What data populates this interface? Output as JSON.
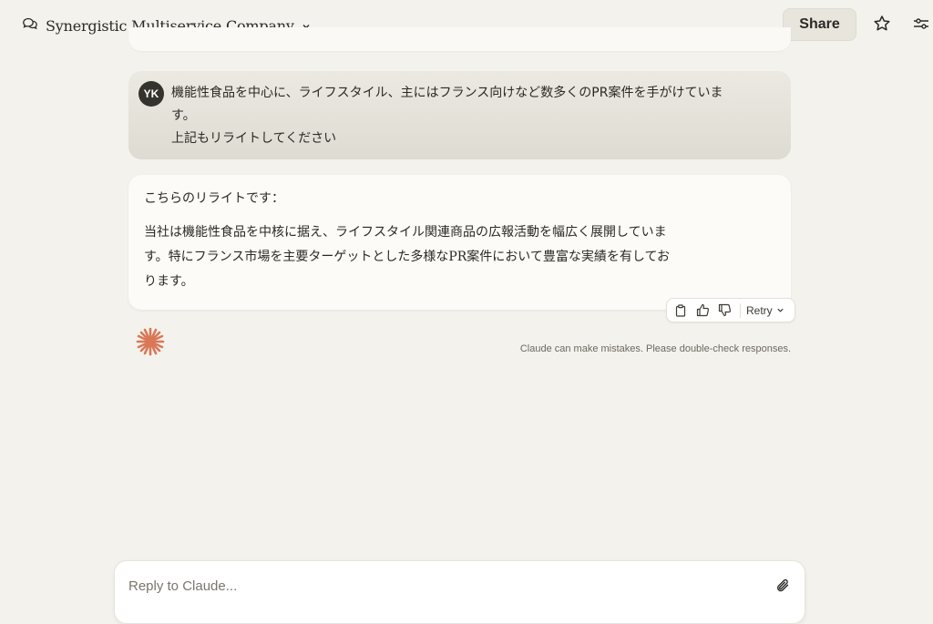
{
  "header": {
    "chat_icon": "chat-bubbles-icon",
    "title": "Synergistic Multiservice Company",
    "title_dropdown_icon": "chevron-down-icon",
    "share_label": "Share",
    "star_icon": "star-icon",
    "settings_icon": "sliders-icon"
  },
  "conversation": {
    "user_message": {
      "avatar_initials": "YK",
      "lines": [
        "機能性食品を中心に、ライフスタイル、主にはフランス向けなど数多くのPR案件を手がけていま",
        "す。",
        "上記もリライトしてください"
      ]
    },
    "assistant_message": {
      "intro": "こちらのリライトです：",
      "body": "当社は機能性食品を中核に据え、ライフスタイル関連商品の広報活動を幅広く展開していま\nす。特にフランス市場を主要ターゲットとした多様なPR案件において豊富な実績を有してお\nります。"
    },
    "actions": {
      "copy_icon": "clipboard-icon",
      "thumbs_up_icon": "thumbs-up-icon",
      "thumbs_down_icon": "thumbs-down-icon",
      "retry_label": "Retry",
      "retry_dropdown_icon": "chevron-down-icon"
    },
    "claude_logo_icon": "claude-spark-icon",
    "disclaimer": "Claude can make mistakes. Please double-check responses."
  },
  "composer": {
    "placeholder": "Reply to Claude...",
    "value": "",
    "attach_icon": "paperclip-icon"
  },
  "colors": {
    "background": "#f4f2ec",
    "user_bubble": "#e4e1d9",
    "assistant_bubble": "#fcfbf8",
    "avatar": "#35332d",
    "claude_accent": "#d97757"
  }
}
